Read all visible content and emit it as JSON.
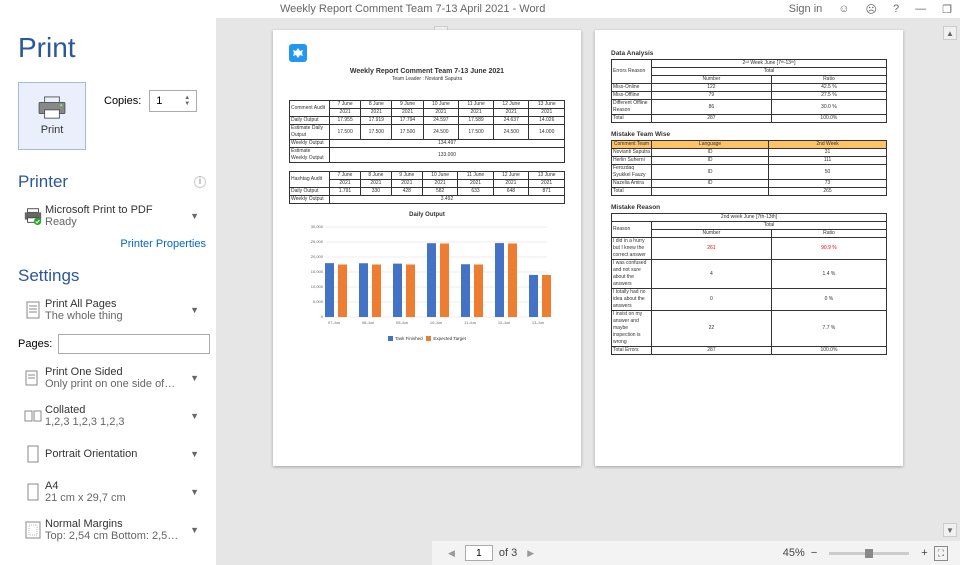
{
  "titlebar": {
    "doc": "Weekly Report Comment Team 7-13 April 2021  -  Word",
    "signin": "Sign in",
    "help": "?",
    "min": "—"
  },
  "print": {
    "heading": "Print",
    "button": "Print",
    "copies_label": "Copies:",
    "copies": "1"
  },
  "printer": {
    "heading": "Printer",
    "name": "Microsoft Print to PDF",
    "status": "Ready",
    "props": "Printer Properties"
  },
  "settings": {
    "heading": "Settings",
    "pages_label": "Pages:",
    "items": [
      {
        "l1": "Print All Pages",
        "l2": "The whole thing",
        "t": "pages-ic"
      },
      {
        "l1": "Print One Sided",
        "l2": "Only print on one side of…",
        "t": "sided-ic"
      },
      {
        "l1": "Collated",
        "l2": "1,2,3    1,2,3    1,2,3",
        "t": "coll-ic"
      },
      {
        "l1": "Portrait Orientation",
        "l2": "",
        "t": "port-ic"
      },
      {
        "l1": "A4",
        "l2": "21 cm x 29,7 cm",
        "t": "a4-ic"
      },
      {
        "l1": "Normal Margins",
        "l2": "Top: 2,54 cm Bottom: 2,5…",
        "t": "marg-ic"
      }
    ]
  },
  "footer": {
    "page": "1",
    "of": "of 3",
    "zoom": "45%"
  },
  "doc": {
    "title": "Weekly Report Comment Team 7-13 June 2021",
    "leader": "Team Leader : Novianti Saputra",
    "audit_cols": [
      "7 June 2021",
      "8 June 2021",
      "9 June 2021",
      "10 June 2021",
      "11 June 2021",
      "12 June 2021",
      "13 June 2021"
    ],
    "comment_audit_label": "Comment Audit",
    "daily_output_label": "Daily Output",
    "daily_output": [
      "17.955",
      "17.919",
      "17.794",
      "24.597",
      "17.589",
      "24.637",
      "14.026"
    ],
    "est_daily_label": "Estimate Daily Output",
    "est_daily": [
      "17.500",
      "17.500",
      "17.500",
      "24.500",
      "17.500",
      "24.500",
      "14.000"
    ],
    "weekly_output_label": "Weekly Output",
    "weekly_output": "134.497",
    "est_wk_label": "Estimate Weekly Output",
    "est_wk": "133.000",
    "hashtag_label": "Hashtag Audit",
    "h_daily": [
      "1.791",
      "330",
      "428",
      "582",
      "633",
      "648",
      "871"
    ],
    "h_weekly": "3.492",
    "data_analysis": "Data Analysis",
    "da_week": "2ⁿᵈ Week June [7ᵗʰ-13ᵗʰ]",
    "da_total": "Total",
    "da_err": "Errors Reason",
    "da_num": "Number",
    "da_ratio": "Ratio",
    "da_rows": [
      [
        "Miss-Online",
        "122",
        "42.5 %"
      ],
      [
        "Miss-Offline",
        "79",
        "27.5 %"
      ],
      [
        "Different Offline Reason",
        "86",
        "30.0 %"
      ],
      [
        "Total",
        "287",
        "100.0%"
      ]
    ],
    "mtw": "Mistake Team Wise",
    "mtw_h": [
      "Comment Team",
      "Language",
      "2nd Week"
    ],
    "mtw_rows": [
      [
        "Novianti Saputra",
        "ID",
        "31"
      ],
      [
        "Herlin Suherni",
        "ID",
        "111"
      ],
      [
        "Ferozdaq Syukkel Fauzy",
        "ID",
        "50"
      ],
      [
        "Nazelia Amira",
        "ID",
        "73"
      ],
      [
        "Total",
        "",
        "265"
      ]
    ],
    "mr": "Mistake Reason",
    "mr_week": "2nd week June [7th-13th]",
    "mr_reason": "Reason",
    "mr_rows": [
      [
        "I did in a hurry but I knew the correct answer",
        "261",
        "90.9 %"
      ],
      [
        "I was confused and not sure about the answers",
        "4",
        "1.4 %"
      ],
      [
        "I totally had no idea about the answers",
        "0",
        "0 %"
      ],
      [
        "I insist on my answer and maybe inspection is wrong",
        "22",
        "7.7 %"
      ],
      [
        "Total Errors",
        "287",
        "100.0%"
      ]
    ]
  },
  "chart_data": {
    "type": "bar",
    "title": "Daily Output",
    "categories": [
      "07-Jun",
      "08-Jun",
      "09-Jun",
      "10-Jun",
      "11-Jun",
      "12-Jun",
      "13-Jun"
    ],
    "series": [
      {
        "name": "Task Finished",
        "values": [
          17955,
          17919,
          17794,
          24597,
          17589,
          24637,
          14026
        ],
        "color": "#4472c4"
      },
      {
        "name": "Expected Target",
        "values": [
          17500,
          17500,
          17500,
          24500,
          17500,
          24500,
          14000
        ],
        "color": "#ed7d31"
      }
    ],
    "ylim": [
      0,
      30000
    ],
    "yticks": [
      0,
      5000,
      10000,
      15000,
      20000,
      25000,
      30000
    ]
  }
}
